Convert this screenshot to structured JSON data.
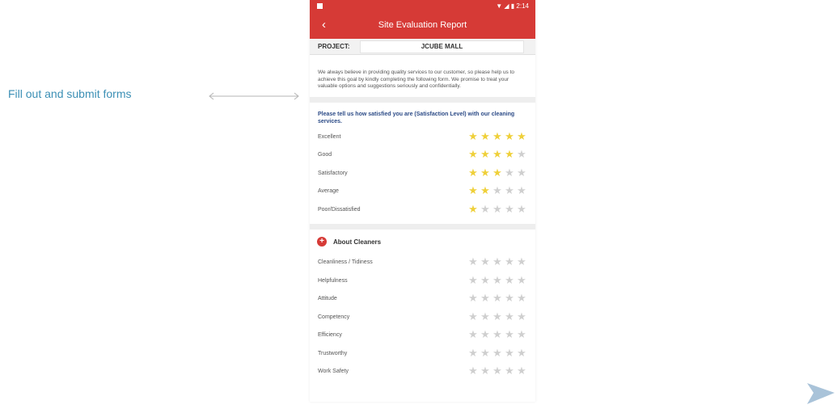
{
  "caption": "Fill out and submit forms",
  "status_bar": {
    "time": "2:14",
    "icons": "▼ ◢ ▮"
  },
  "app_bar": {
    "back_icon": "chevron-left-icon",
    "title": "Site Evaluation Report"
  },
  "project": {
    "label": "PROJECT:",
    "value": "JCUBE MALL"
  },
  "intro_text": "We always believe in providing quality services to our customer, so please help us to achieve this goal by kindly completing the following form. We promise to treat your valuable options and suggestions seriously and confidentially.",
  "question": "Please tell us how satisfied you are (Satisfaction Level) with our cleaning services.",
  "legend": [
    {
      "label": "Excellent",
      "rating": 5
    },
    {
      "label": "Good",
      "rating": 4
    },
    {
      "label": "Satisfactory",
      "rating": 3
    },
    {
      "label": "Average",
      "rating": 2
    },
    {
      "label": "Poor/Dissatisfied",
      "rating": 1
    }
  ],
  "section": {
    "title": "About Cleaners",
    "items": [
      {
        "label": "Cleanliness / Tidiness",
        "rating": 0
      },
      {
        "label": "Helpfulness",
        "rating": 0
      },
      {
        "label": "Attitude",
        "rating": 0
      },
      {
        "label": "Competency",
        "rating": 0
      },
      {
        "label": "Efficiency",
        "rating": 0
      },
      {
        "label": "Trustworthy",
        "rating": 0
      },
      {
        "label": "Work Safety",
        "rating": 0
      }
    ]
  },
  "colors": {
    "brand_red": "#d63a36",
    "star_on": "#efd03a",
    "star_off": "#cfcfcf",
    "caption": "#3b8fb5"
  }
}
